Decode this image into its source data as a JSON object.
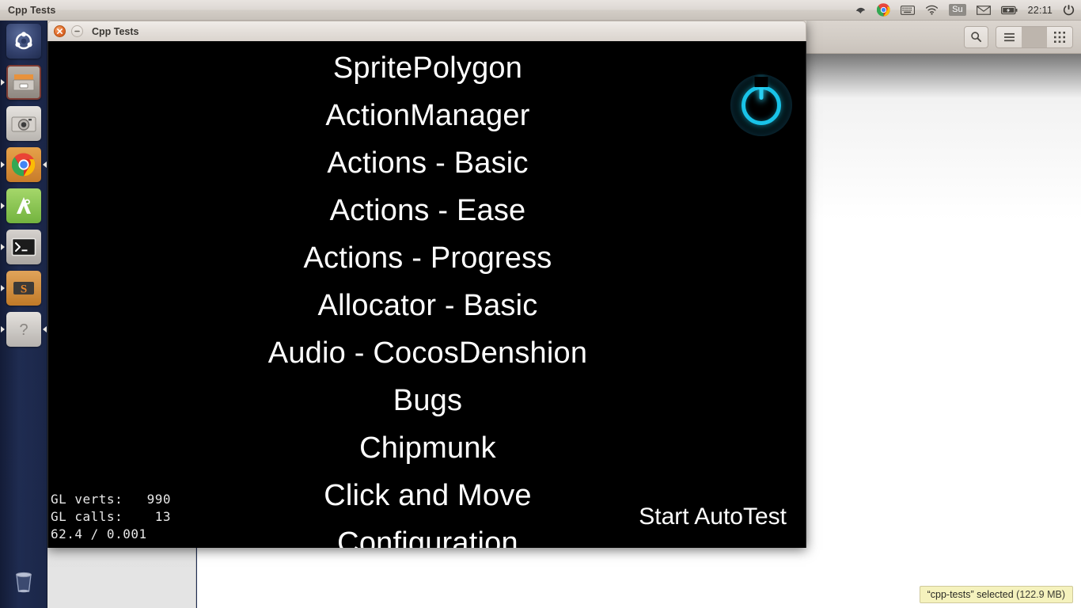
{
  "panel": {
    "app_title": "Cpp Tests",
    "clock": "22:11",
    "tray_icons": [
      "dropbox-icon",
      "chrome-icon",
      "keyboard-indicator-icon",
      "wifi-icon",
      "input-method-su-icon",
      "mail-icon",
      "battery-icon",
      "power-menu-icon"
    ],
    "input_method_label": "Su"
  },
  "launcher": {
    "items": [
      {
        "name": "ubuntu-dash-home",
        "label": "Dash Home"
      },
      {
        "name": "files-nautilus",
        "label": "Files"
      },
      {
        "name": "shotwell-photos",
        "label": "Shotwell Photo Manager"
      },
      {
        "name": "google-chrome",
        "label": "Google Chrome"
      },
      {
        "name": "android-studio",
        "label": "Android Studio"
      },
      {
        "name": "terminal",
        "label": "Terminal"
      },
      {
        "name": "sublime-text",
        "label": "Sublime Text"
      },
      {
        "name": "help",
        "label": "Ubuntu Help"
      }
    ],
    "trash": {
      "name": "trash",
      "label": "Trash"
    }
  },
  "nautilus": {
    "toolbar": {
      "search_label": "Search",
      "list_view_label": "List view",
      "grid_view_label": "Grid view"
    },
    "status": {
      "selection": "“cpp-tests” selected",
      "size": "(122.9 MB)"
    }
  },
  "game_window": {
    "title": "Cpp Tests",
    "close_label": "×",
    "minimize_label": "−",
    "power_icon": "power-icon",
    "autotest_button": "Start AutoTest",
    "menu_items": [
      "SpritePolygon",
      "ActionManager",
      "Actions - Basic",
      "Actions - Ease",
      "Actions - Progress",
      "Allocator - Basic",
      "Audio - CocosDenshion",
      "Bugs",
      "Chipmunk",
      "Click and Move",
      "Configuration"
    ],
    "stats": {
      "verts_label": "GL verts:",
      "verts_value": "990",
      "calls_label": "GL calls:",
      "calls_value": "13",
      "fps_line": "62.4 / 0.001"
    }
  },
  "colors": {
    "accent_cyan": "#19c3e8",
    "close_orange": "#e06a2b",
    "tooltip_yellow": "#f5f2bd",
    "launcher_blue": "#1e2a4a"
  }
}
